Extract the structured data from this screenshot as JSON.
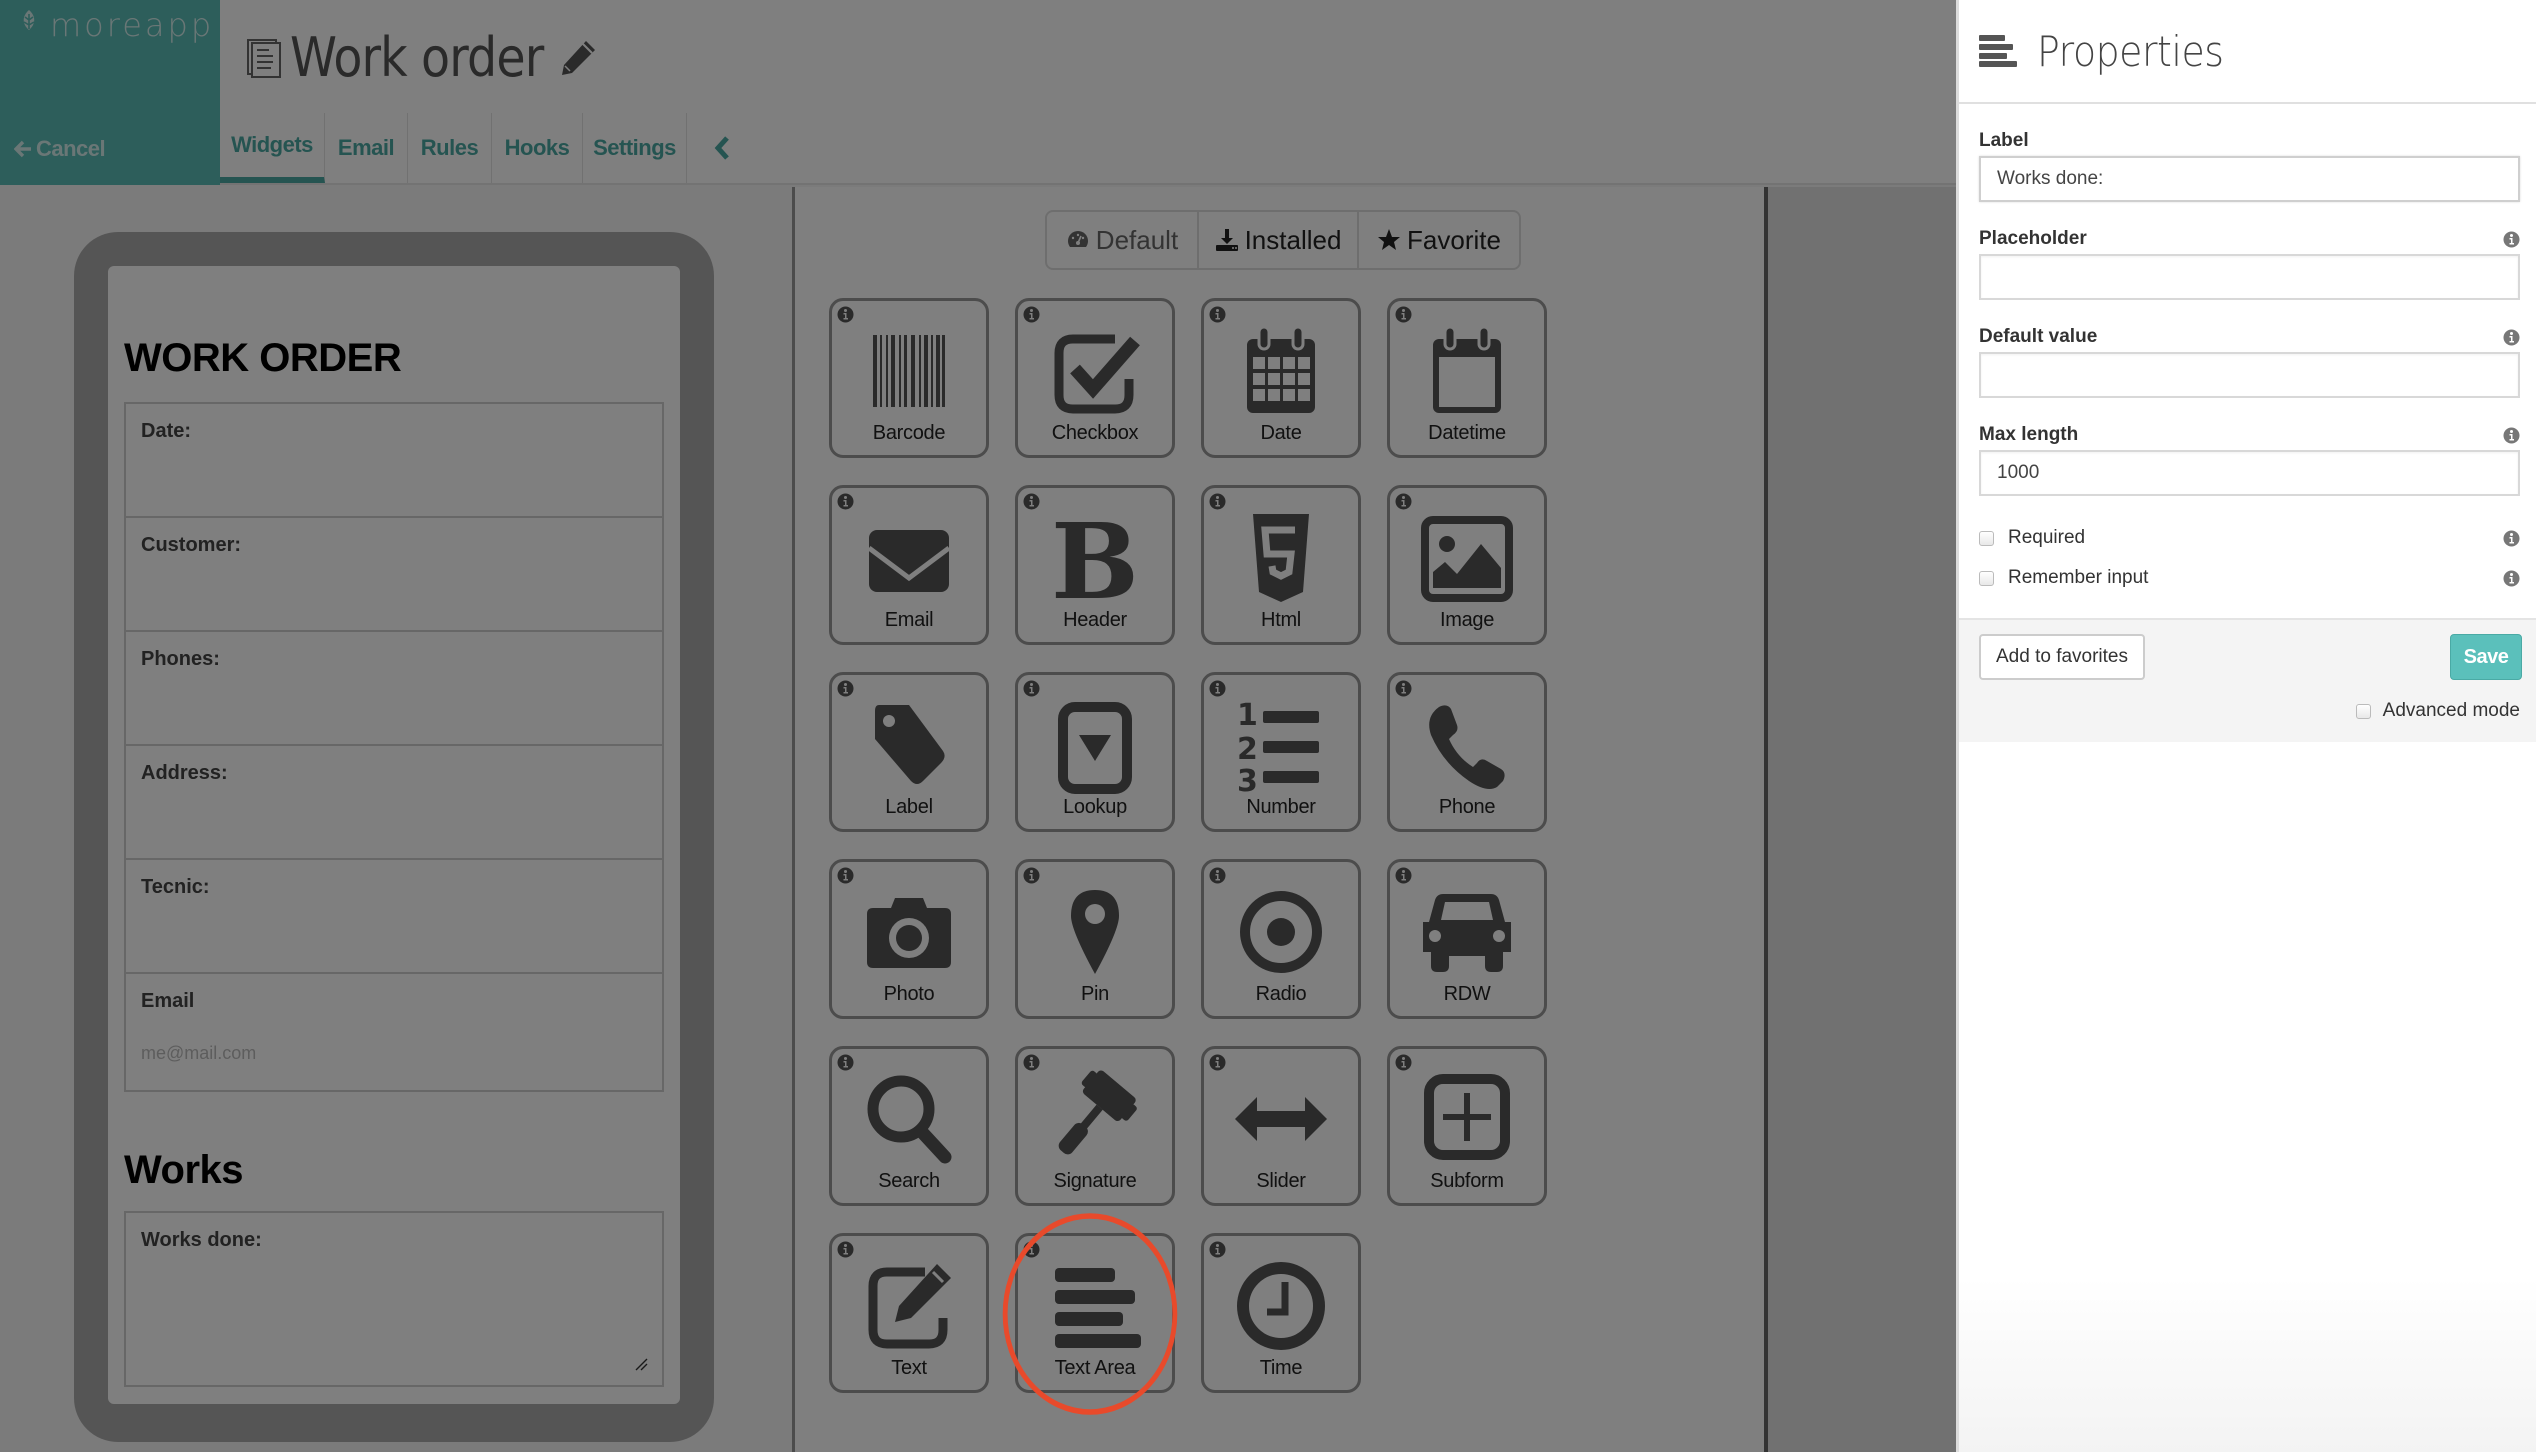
{
  "brand": {
    "name": "moreapp",
    "logo_icon": "leaf-icon"
  },
  "nav": {
    "cancel_label": "Cancel",
    "cancel_icon": "arrow-left-icon"
  },
  "header": {
    "title": "Work order",
    "title_icon": "document-icon",
    "edit_icon": "pencil-icon",
    "tabs": [
      {
        "label": "Widgets",
        "active": true
      },
      {
        "label": "Email",
        "active": false
      },
      {
        "label": "Rules",
        "active": false
      },
      {
        "label": "Hooks",
        "active": false
      },
      {
        "label": "Settings",
        "active": false
      }
    ],
    "collapse_icon": "chevron-left-icon"
  },
  "preview": {
    "sections": [
      {
        "heading": "WORK ORDER",
        "fields": [
          {
            "label": "Date:",
            "placeholder": ""
          },
          {
            "label": "Customer:",
            "placeholder": ""
          },
          {
            "label": "Phones:",
            "placeholder": ""
          },
          {
            "label": "Address:",
            "placeholder": ""
          },
          {
            "label": "Tecnic:",
            "placeholder": ""
          },
          {
            "label": "Email",
            "placeholder": "me@mail.com"
          }
        ]
      },
      {
        "heading": "Works",
        "textarea": {
          "label": "Works done:"
        }
      }
    ]
  },
  "palette": {
    "filters": [
      {
        "label": "Default",
        "icon": "dashboard-icon",
        "active": false
      },
      {
        "label": "Installed",
        "icon": "download-icon",
        "active": true
      },
      {
        "label": "Favorite",
        "icon": "star-icon",
        "active": false
      }
    ],
    "widgets": [
      {
        "label": "Barcode",
        "icon": "barcode-icon"
      },
      {
        "label": "Checkbox",
        "icon": "checkbox-icon"
      },
      {
        "label": "Date",
        "icon": "calendar-grid-icon"
      },
      {
        "label": "Datetime",
        "icon": "calendar-icon"
      },
      {
        "label": "Email",
        "icon": "envelope-icon"
      },
      {
        "label": "Header",
        "icon": "bold-b-icon"
      },
      {
        "label": "Html",
        "icon": "html5-icon"
      },
      {
        "label": "Image",
        "icon": "picture-icon"
      },
      {
        "label": "Label",
        "icon": "tag-icon"
      },
      {
        "label": "Lookup",
        "icon": "dropdown-icon"
      },
      {
        "label": "Number",
        "icon": "ordered-list-icon"
      },
      {
        "label": "Phone",
        "icon": "phone-icon"
      },
      {
        "label": "Photo",
        "icon": "camera-icon"
      },
      {
        "label": "Pin",
        "icon": "map-pin-icon"
      },
      {
        "label": "Radio",
        "icon": "radio-icon"
      },
      {
        "label": "RDW",
        "icon": "car-icon"
      },
      {
        "label": "Search",
        "icon": "magnifier-icon"
      },
      {
        "label": "Signature",
        "icon": "gavel-icon"
      },
      {
        "label": "Slider",
        "icon": "arrows-horizontal-icon"
      },
      {
        "label": "Subform",
        "icon": "plus-square-icon"
      },
      {
        "label": "Text",
        "icon": "edit-icon"
      },
      {
        "label": "Text Area",
        "icon": "align-left-icon",
        "highlighted": true
      },
      {
        "label": "Time",
        "icon": "clock-icon"
      }
    ],
    "highlight_color": "#e84a2b"
  },
  "properties": {
    "title": "Properties",
    "title_icon": "align-left-icon",
    "fields": [
      {
        "label": "Label",
        "value": "Works done:",
        "placeholder": "",
        "has_info": false
      },
      {
        "label": "Placeholder",
        "value": "",
        "placeholder": "",
        "has_info": true
      },
      {
        "label": "Default value",
        "value": "",
        "placeholder": "",
        "has_info": true
      },
      {
        "label": "Max length",
        "value": "1000",
        "placeholder": "",
        "has_info": true
      }
    ],
    "checkboxes": [
      {
        "label": "Required",
        "checked": false,
        "has_info": true
      },
      {
        "label": "Remember input",
        "checked": false,
        "has_info": true
      }
    ],
    "add_favorites_label": "Add to favorites",
    "save_label": "Save",
    "advanced_mode_label": "Advanced mode",
    "advanced_mode_checked": false
  },
  "colors": {
    "brand_teal": "#5abcb7",
    "tab_teal": "#4aa8a2",
    "save_button": "#5bc0bb",
    "overlay": "rgba(0,0,0,0.5)"
  }
}
